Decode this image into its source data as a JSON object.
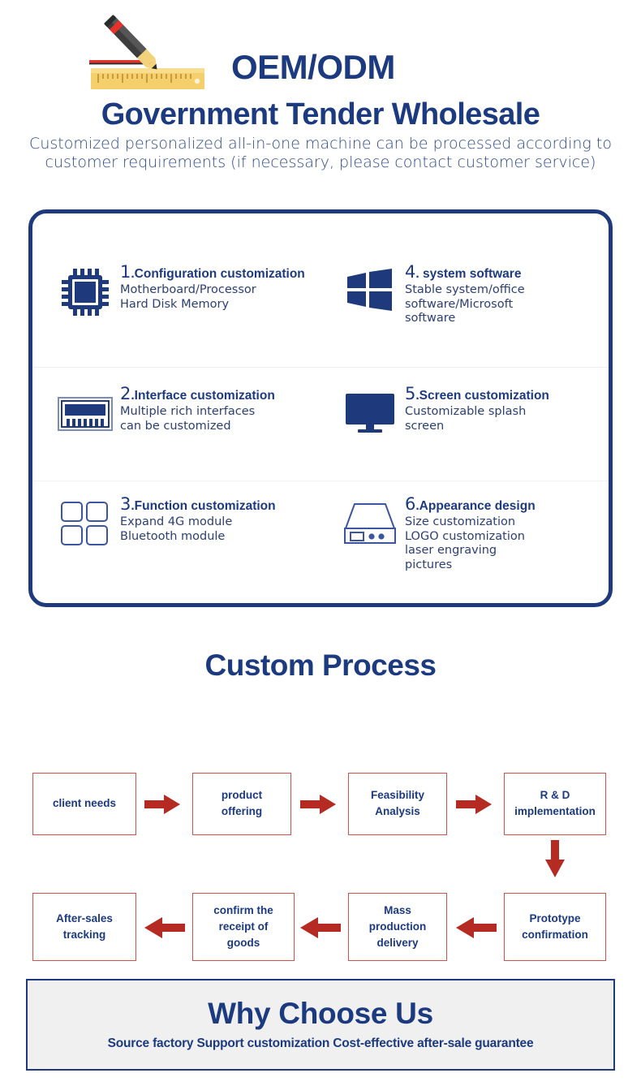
{
  "hero": {
    "icon": "pencil-ruler-icon",
    "oem_title": "OEM/ODM",
    "main_title": "Government Tender Wholesale",
    "subtitle": "Customized personalized all-in-one\nmachine can be processed according to customer requirements\n(if necessary, please contact customer service)",
    "highlight_color": "#a9c3e8",
    "title_color": "#1c3a80"
  },
  "features": {
    "border_color": "#1e3a7c",
    "items": [
      {
        "number": "1",
        "title": ".Configuration customization",
        "desc": "Motherboard/Processor\nHard Disk Memory",
        "icon": "cpu-chip-icon"
      },
      {
        "number": "4",
        "title": ". system software",
        "desc": "Stable system/office\nsoftware/Microsoft\nsoftware",
        "icon": "windows-logo-icon"
      },
      {
        "number": "2",
        "title": ".Interface customization",
        "desc": "Multiple rich interfaces\ncan be customized",
        "icon": "io-port-icon"
      },
      {
        "number": "5",
        "title": ".Screen customization",
        "desc": "Customizable splash\nscreen",
        "icon": "monitor-icon"
      },
      {
        "number": "3",
        "title": ".Function customization",
        "desc": "Expand 4G module\nBluetooth module",
        "icon": "four-squares-module-icon"
      },
      {
        "number": "6",
        "title": ".Appearance design",
        "desc": "Size customization\nLOGO customization\n laser engraving\n pictures",
        "icon": "device-case-icon"
      }
    ]
  },
  "process": {
    "title": "Custom Process",
    "highlight_color": "#a9c3e8",
    "box_border_color": "#d0524a",
    "arrow_color": "#b52a22",
    "steps_row1": [
      "client needs",
      "product\noffering",
      "Feasibility\nAnalysis",
      "R & D\nimplementation"
    ],
    "steps_row2": [
      "After-sales\ntracking",
      "confirm the\nreceipt of\ngoods",
      "Mass\nproduction\ndelivery",
      "Prototype\nconfirmation"
    ]
  },
  "why_choose": {
    "title": "Why Choose Us",
    "subtitle": "Source factory Support customization Cost-effective after-sale guarantee",
    "border_color": "#1e3a7c",
    "background": "#f0f0f0"
  }
}
